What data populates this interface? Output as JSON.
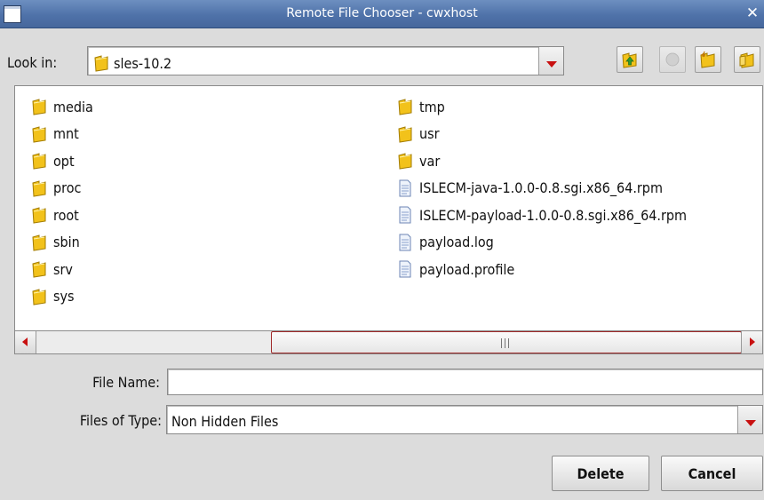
{
  "window": {
    "title": "Remote File Chooser - cwxhost"
  },
  "look_in": {
    "label": "Look in:",
    "value": "sles-10.2"
  },
  "toolbar": {
    "up_folder": "up-folder-icon",
    "home": "home-icon",
    "new_folder": "new-folder-icon",
    "list_view": "list-view-icon"
  },
  "files": {
    "column1": [
      {
        "name": "media",
        "icon": "folder-icon"
      },
      {
        "name": "mnt",
        "icon": "folder-icon"
      },
      {
        "name": "opt",
        "icon": "folder-icon"
      },
      {
        "name": "proc",
        "icon": "folder-icon"
      },
      {
        "name": "root",
        "icon": "folder-icon"
      },
      {
        "name": "sbin",
        "icon": "folder-icon"
      },
      {
        "name": "srv",
        "icon": "folder-icon"
      },
      {
        "name": "sys",
        "icon": "folder-icon"
      }
    ],
    "column2": [
      {
        "name": "tmp",
        "icon": "folder-icon"
      },
      {
        "name": "usr",
        "icon": "folder-icon"
      },
      {
        "name": "var",
        "icon": "folder-icon"
      },
      {
        "name": "ISLECM-java-1.0.0-0.8.sgi.x86_64.rpm",
        "icon": "file-icon"
      },
      {
        "name": "ISLECM-payload-1.0.0-0.8.sgi.x86_64.rpm",
        "icon": "file-icon"
      },
      {
        "name": "payload.log",
        "icon": "file-icon"
      },
      {
        "name": "payload.profile",
        "icon": "file-icon"
      }
    ]
  },
  "file_name": {
    "label": "File Name:",
    "value": "",
    "placeholder": ""
  },
  "files_of_type": {
    "label": "Files of Type:",
    "value": "Non Hidden Files"
  },
  "buttons": {
    "delete": "Delete",
    "cancel": "Cancel"
  },
  "colors": {
    "titlebar": "#5677ad",
    "arrow": "#c81010",
    "folder": "#f2c21b"
  }
}
